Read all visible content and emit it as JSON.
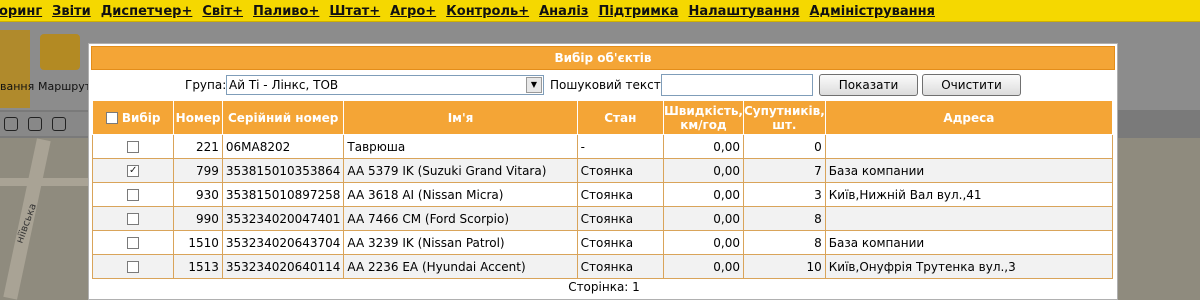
{
  "menu": [
    "оринг",
    "Звіти",
    "Диспетчер+",
    "Світ+",
    "Паливо+",
    "Штат+",
    "Агро+",
    "Контроль+",
    "Аналіз",
    "Підтримка",
    "Налаштування",
    "Адміністрування"
  ],
  "background": {
    "left_button_label": "вання",
    "route_button_label": "Маршрути",
    "street_label": "ніївська"
  },
  "modal": {
    "title": "Вибір об'єктів",
    "group_label": "Група:",
    "group_value": "Ай Ті - Лінкс, ТОВ",
    "search_label": "Пошуковий текст:",
    "search_value": "",
    "show_button": "Показати",
    "clear_button": "Очистити",
    "pager": "Сторінка: 1"
  },
  "table": {
    "headers": {
      "select": "Вибір",
      "number": "Номер",
      "serial": "Серійний номер",
      "name": "Ім'я",
      "state": "Стан",
      "speed": "Швидкість, км/год",
      "satellites": "Супутників, шт.",
      "address": "Адреса"
    },
    "rows": [
      {
        "checked": false,
        "number": "221",
        "serial": "06MA8202",
        "name": "Таврюша",
        "state": "-",
        "speed": "0,00",
        "satellites": "0",
        "address": ""
      },
      {
        "checked": true,
        "number": "799",
        "serial": "353815010353864",
        "name": "AA 5379 IK (Suzuki Grand Vitara)",
        "state": "Стоянка",
        "speed": "0,00",
        "satellites": "7",
        "address": "База компании"
      },
      {
        "checked": false,
        "number": "930",
        "serial": "353815010897258",
        "name": "AA 3618 AI (Nissan Micra)",
        "state": "Стоянка",
        "speed": "0,00",
        "satellites": "3",
        "address": "Київ,Нижній Вал вул.,41"
      },
      {
        "checked": false,
        "number": "990",
        "serial": "353234020047401",
        "name": "AA 7466 CM (Ford Scorpio)",
        "state": "Стоянка",
        "speed": "0,00",
        "satellites": "8",
        "address": ""
      },
      {
        "checked": false,
        "number": "1510",
        "serial": "353234020643704",
        "name": "AA 3239 IK (Nissan Patrol)",
        "state": "Стоянка",
        "speed": "0,00",
        "satellites": "8",
        "address": "База компании"
      },
      {
        "checked": false,
        "number": "1513",
        "serial": "353234020640114",
        "name": "AA 2236 EA (Hyundai Accent)",
        "state": "Стоянка",
        "speed": "0,00",
        "satellites": "10",
        "address": "Київ,Онуфрія Трутенка вул.,3"
      }
    ]
  },
  "colors": {
    "menubar": "#f5d800",
    "header_orange": "#f4a536",
    "row_border": "#d9a45a"
  }
}
